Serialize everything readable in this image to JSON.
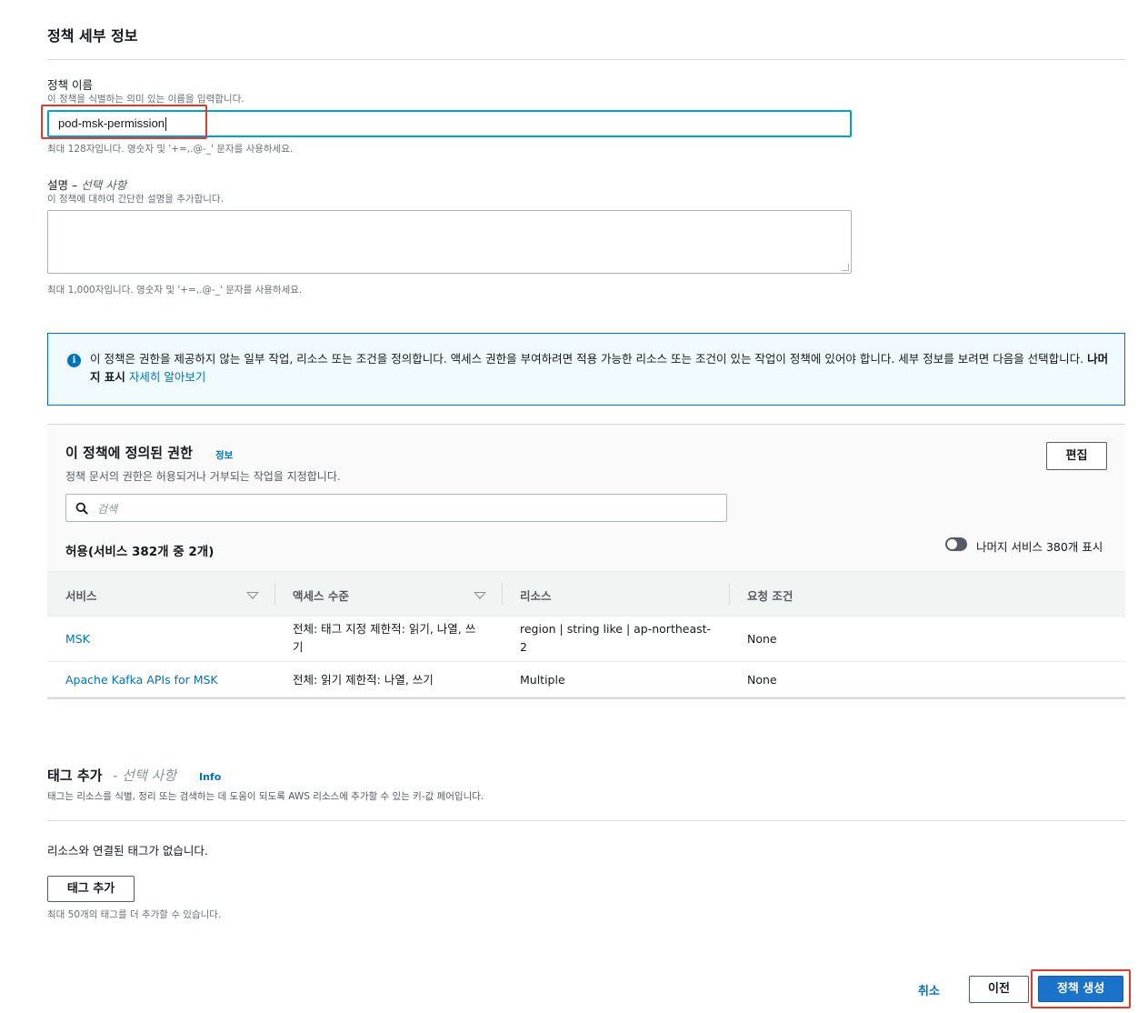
{
  "details": {
    "section_title": "정책 세부 정보",
    "name_label": "정책 이름",
    "name_desc": "이 정책을 식별하는 의미 있는 이름을 입력합니다.",
    "name_value": "pod-msk-permission",
    "name_hint": "최대 128자입니다. 영숫자 및 '+=,.@-_' 문자를 사용하세요.",
    "desc_label": "설명 –",
    "desc_optional": "선택 사항",
    "desc_desc": "이 정책에 대하여 간단한 설명을 추가합니다.",
    "desc_value": "",
    "desc_hint": "최대 1,000자입니다. 영숫자 및 '+=,.@-_' 문자를 사용하세요."
  },
  "alert": {
    "icon": "info-icon",
    "text": "이 정책은 권한을 제공하지 않는 일부 작업, 리소스 또는 조건을 정의합니다. 액세스 권한을 부여하려면 적용 가능한 리소스 또는 조건이 있는 작업이 정책에 있어야 합니다. 세부 정보를 보려면 다음을 선택합니다.",
    "bold": "나머지 표시",
    "link": "자세히 알아보기"
  },
  "permissions": {
    "title": "이 정책에 정의된 권한",
    "info_link": "정보",
    "desc": "정책 문서의 권한은 허용되거나 거부되는 작업을 지정합니다.",
    "edit_label": "편집",
    "search_placeholder": "검색",
    "allow_title": "허용(서비스 382개 중 2개)",
    "toggle_label": "나머지 서비스 380개 표시",
    "toggle_on": false,
    "columns": [
      "서비스",
      "액세스 수준",
      "리소스",
      "요청 조건"
    ],
    "rows": [
      {
        "service": "MSK",
        "access_line1": "전체: 태그 지정 제한적: 읽기, 나열, 쓰",
        "access_line2": "기",
        "resource_line1": "region | string like | ap-northeast-",
        "resource_line2": "2",
        "conditions": "None"
      },
      {
        "service": "Apache Kafka APIs for MSK",
        "access": "전체: 읽기 제한적: 나열, 쓰기",
        "resource": "Multiple",
        "conditions": "None"
      }
    ]
  },
  "tags": {
    "title": "태그 추가",
    "optional": "- 선택 사항",
    "info_link": "Info",
    "desc": "태그는 리소스를 식별, 정리 또는 검색하는 데 도움이 되도록 AWS 리소스에 추가할 수 있는 키-값 페어입니다.",
    "empty": "리소스와 연결된 태그가 없습니다.",
    "add_label": "태그 추가",
    "hint": "최대 50개의 태그를 더 추가할 수 있습니다."
  },
  "footer": {
    "cancel": "취소",
    "previous": "이전",
    "create": "정책 생성"
  },
  "colors": {
    "primary": "#1a73c8",
    "link": "#0073bb",
    "highlight": "#e0392e"
  }
}
